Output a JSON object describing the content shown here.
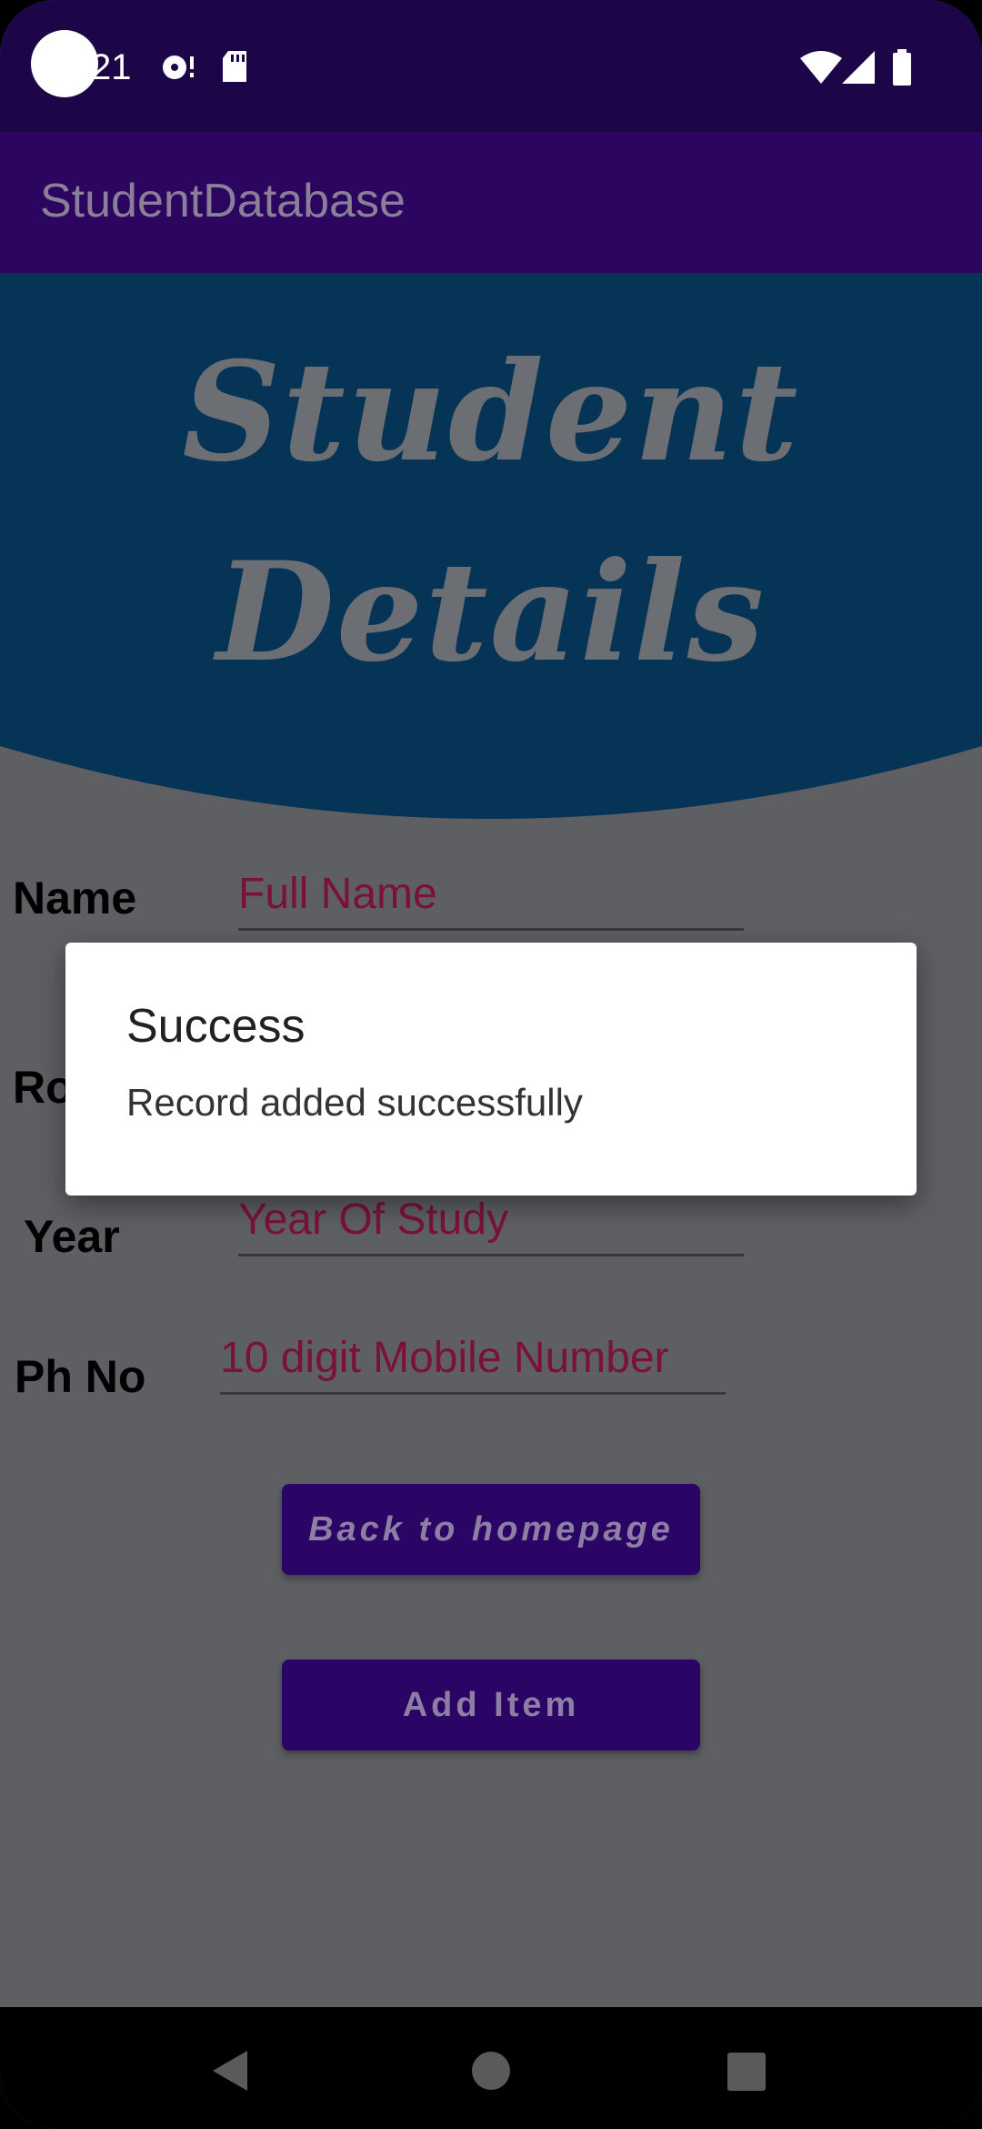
{
  "status_bar": {
    "time": "21"
  },
  "app_bar": {
    "title": "StudentDatabase"
  },
  "header": {
    "line1": "Student",
    "line2": "Details"
  },
  "form": {
    "name": {
      "label": "Name",
      "placeholder": "Full Name"
    },
    "roll": {
      "label": "Ro"
    },
    "year": {
      "label": "Year",
      "placeholder": "Year Of Study"
    },
    "phone": {
      "label": "Ph No",
      "placeholder": "10 digit Mobile Number"
    }
  },
  "buttons": {
    "back": "Back to homepage",
    "add": "Add Item"
  },
  "dialog": {
    "title": "Success",
    "message": "Record added successfully"
  },
  "colors": {
    "status_bar": "#1d0648",
    "app_bar": "#2b0560",
    "header": "#063457",
    "button": "#2a0566",
    "placeholder": "#7a1238"
  }
}
